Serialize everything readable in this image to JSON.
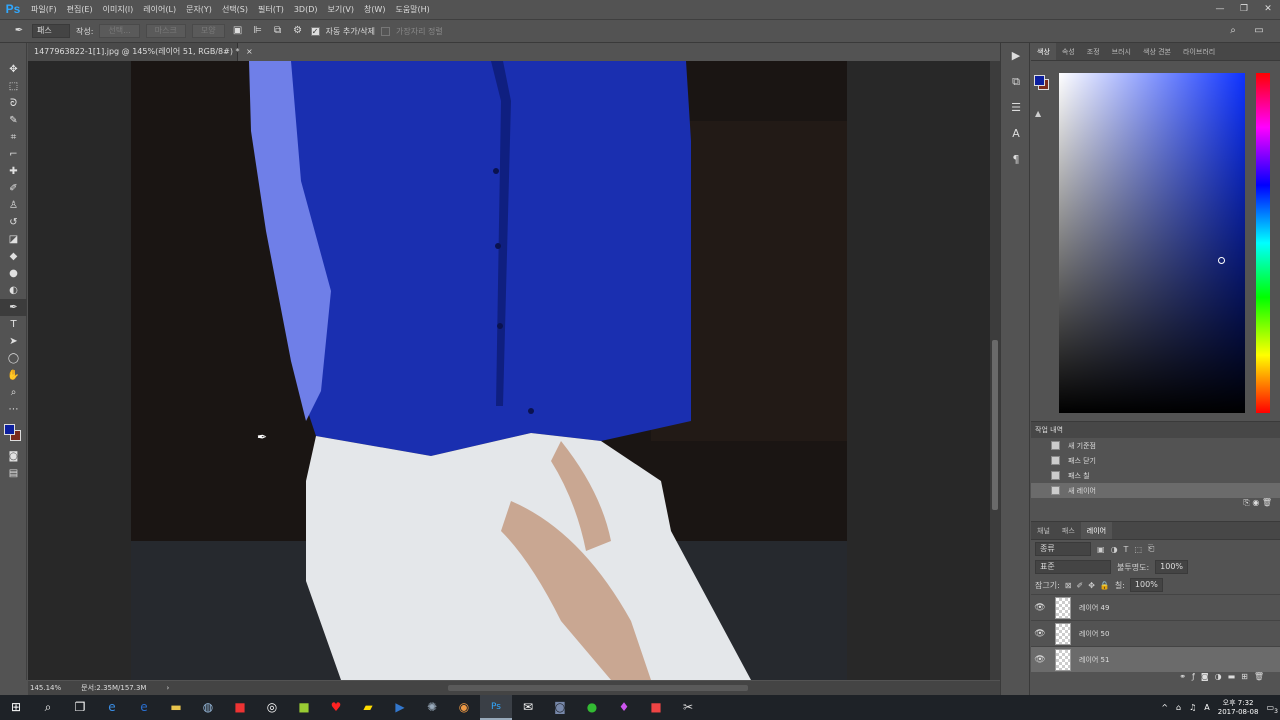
{
  "app": {
    "logo": "Ps"
  },
  "menu": [
    "파일(F)",
    "편집(E)",
    "이미지(I)",
    "레이어(L)",
    "문자(Y)",
    "선택(S)",
    "필터(T)",
    "3D(D)",
    "보기(V)",
    "창(W)",
    "도움말(H)"
  ],
  "window_controls": [
    "—",
    "❐",
    "✕"
  ],
  "options": {
    "mode_value": "패스",
    "make_label": "작성:",
    "selection_btn": "선택...",
    "mask_btn": "마스크",
    "shape_btn": "모양",
    "auto_add_label": "자동 추가/삭제",
    "align_edges_label": "가장자리 정렬"
  },
  "document": {
    "tab_title": "1477963822-1[1].jpg @ 145%(레이어 51, RGB/8#) *",
    "close": "×"
  },
  "status": {
    "zoom": "145.14%",
    "doc_size": "문서:2.35M/157.3M",
    "arrow": "›"
  },
  "panels": {
    "color_tabs": [
      "색상",
      "속성",
      "조정",
      "브러시",
      "색상 견본",
      "라이브러리"
    ],
    "history_title": "작업 내역",
    "history_items": [
      "새 기준점",
      "패스 닫기",
      "패스 칠",
      "새 레이어"
    ],
    "layers_tabs": [
      "채널",
      "패스",
      "레이어"
    ],
    "layers_kind": "종류",
    "blend_mode": "표준",
    "opacity_label": "불투명도:",
    "opacity_value": "100%",
    "lock_label": "잠그기:",
    "fill_label": "칠:",
    "fill_value": "100%",
    "layers": [
      {
        "name": "레이어 49"
      },
      {
        "name": "레이어 50"
      },
      {
        "name": "레이어 51"
      }
    ]
  },
  "tray": {
    "ime": "A",
    "time_ampm": "오후 7:32",
    "date": "2017-08-08",
    "notif_count": "3"
  },
  "colors": {
    "foreground": "#0c1f9e",
    "background": "#7a2a1c",
    "shirt": "#1a2fb0"
  }
}
